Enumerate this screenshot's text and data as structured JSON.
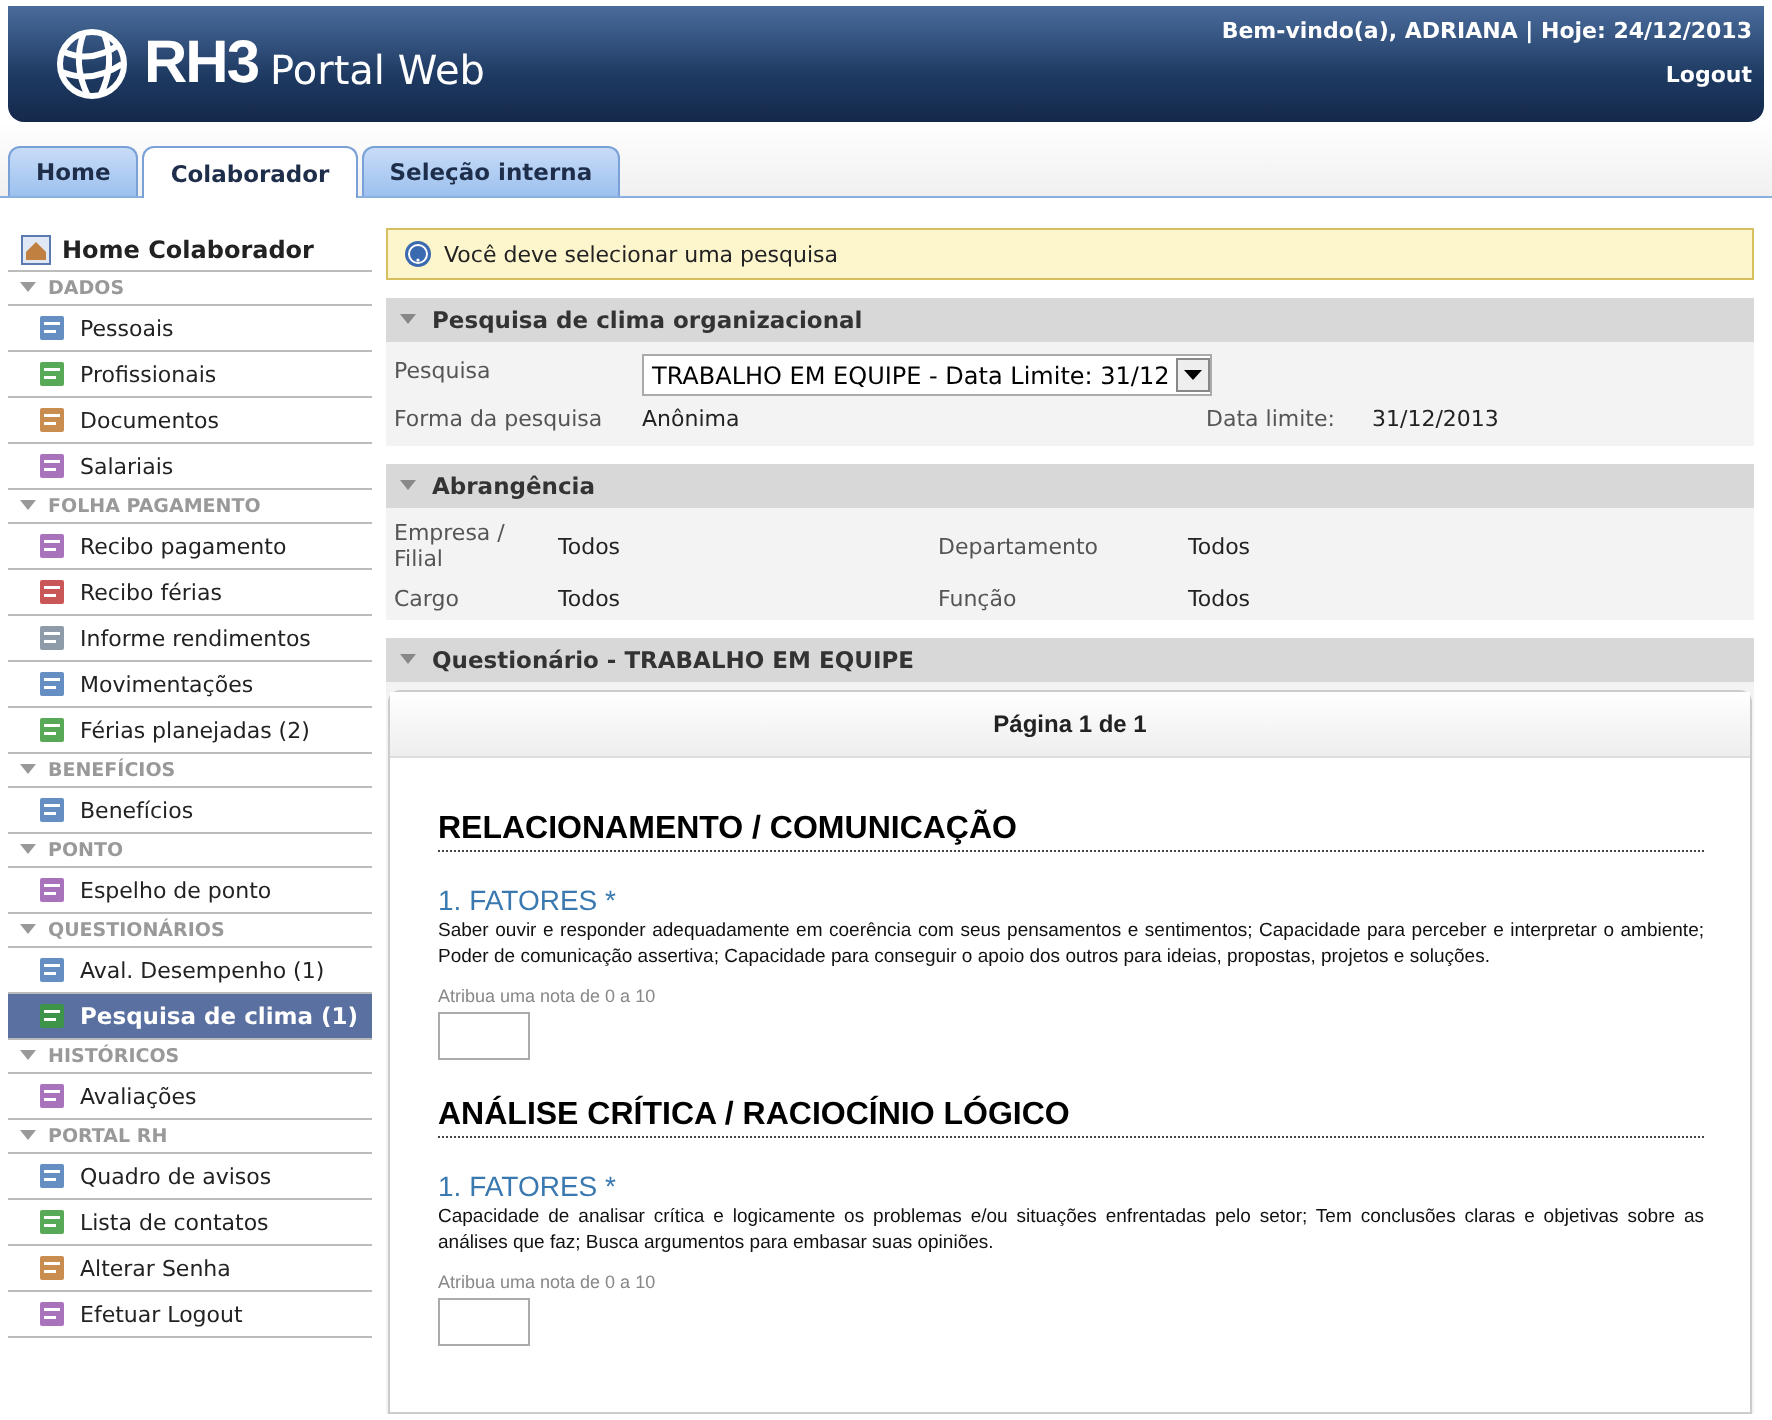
{
  "header": {
    "logo_mark": "RH3",
    "logo_text": "Portal Web",
    "welcome": "Bem-vindo(a), ADRIANA | Hoje: 24/12/2013",
    "logout": "Logout"
  },
  "tabs": [
    {
      "label": "Home",
      "selected": false
    },
    {
      "label": "Colaborador",
      "selected": true
    },
    {
      "label": "Seleção interna",
      "selected": false
    }
  ],
  "sidebar": {
    "home": "Home Colaborador",
    "sections": [
      {
        "title": "DADOS",
        "items": [
          {
            "label": "Pessoais",
            "selected": false
          },
          {
            "label": "Profissionais",
            "selected": false
          },
          {
            "label": "Documentos",
            "selected": false
          },
          {
            "label": "Salariais",
            "selected": false
          }
        ]
      },
      {
        "title": "FOLHA PAGAMENTO",
        "items": [
          {
            "label": "Recibo pagamento",
            "selected": false
          },
          {
            "label": "Recibo férias",
            "selected": false
          },
          {
            "label": "Informe rendimentos",
            "selected": false
          },
          {
            "label": "Movimentações",
            "selected": false
          },
          {
            "label": "Férias planejadas (2)",
            "selected": false
          }
        ]
      },
      {
        "title": "BENEFÍCIOS",
        "items": [
          {
            "label": "Benefícios",
            "selected": false
          }
        ]
      },
      {
        "title": "PONTO",
        "items": [
          {
            "label": "Espelho de ponto",
            "selected": false
          }
        ]
      },
      {
        "title": "QUESTIONÁRIOS",
        "items": [
          {
            "label": "Aval. Desempenho (1)",
            "selected": false
          },
          {
            "label": "Pesquisa de clima (1)",
            "selected": true
          }
        ]
      },
      {
        "title": "HISTÓRICOS",
        "items": [
          {
            "label": "Avaliações",
            "selected": false
          }
        ]
      },
      {
        "title": "PORTAL RH",
        "items": [
          {
            "label": "Quadro de avisos",
            "selected": false
          },
          {
            "label": "Lista de contatos",
            "selected": false
          },
          {
            "label": "Alterar Senha",
            "selected": false
          },
          {
            "label": "Efetuar Logout",
            "selected": false
          }
        ]
      }
    ]
  },
  "notice": "Você deve selecionar uma pesquisa",
  "survey_panel": {
    "title": "Pesquisa de clima organizacional",
    "pesquisa_label": "Pesquisa",
    "pesquisa_value": "TRABALHO EM EQUIPE - Data Limite: 31/12",
    "forma_label": "Forma da pesquisa",
    "forma_value": "Anônima",
    "data_label": "Data limite:",
    "data_value": "31/12/2013"
  },
  "scope_panel": {
    "title": "Abrangência",
    "fields": [
      {
        "label": "Empresa / Filial",
        "value": "Todos"
      },
      {
        "label": "Departamento",
        "value": "Todos"
      },
      {
        "label": "Cargo",
        "value": "Todos"
      },
      {
        "label": "Função",
        "value": "Todos"
      }
    ]
  },
  "questionnaire": {
    "title": "Questionário - TRABALHO EM EQUIPE",
    "page": "Página 1 de 1",
    "groups": [
      {
        "heading": "RELACIONAMENTO / COMUNICAÇÃO",
        "question": "1. FATORES *",
        "description": "Saber ouvir e responder adequadamente em coerência com seus pensamentos e sentimentos; Capacidade para perceber e interpretar o ambiente; Poder de comunicação assertiva; Capacidade para conseguir o apoio dos outros para ideias, propostas, projetos e soluções.",
        "hint": "Atribua uma nota de 0 a 10"
      },
      {
        "heading": "ANÁLISE CRÍTICA / RACIOCÍNIO LÓGICO",
        "question": "1. FATORES *",
        "description": "Capacidade de analisar crítica e logicamente os problemas e/ou situações enfrentadas pelo setor; Tem conclusões claras e objetivas sobre as análises que faz; Busca argumentos para embasar suas opiniões.",
        "hint": "Atribua uma nota de 0 a 10"
      }
    ]
  }
}
